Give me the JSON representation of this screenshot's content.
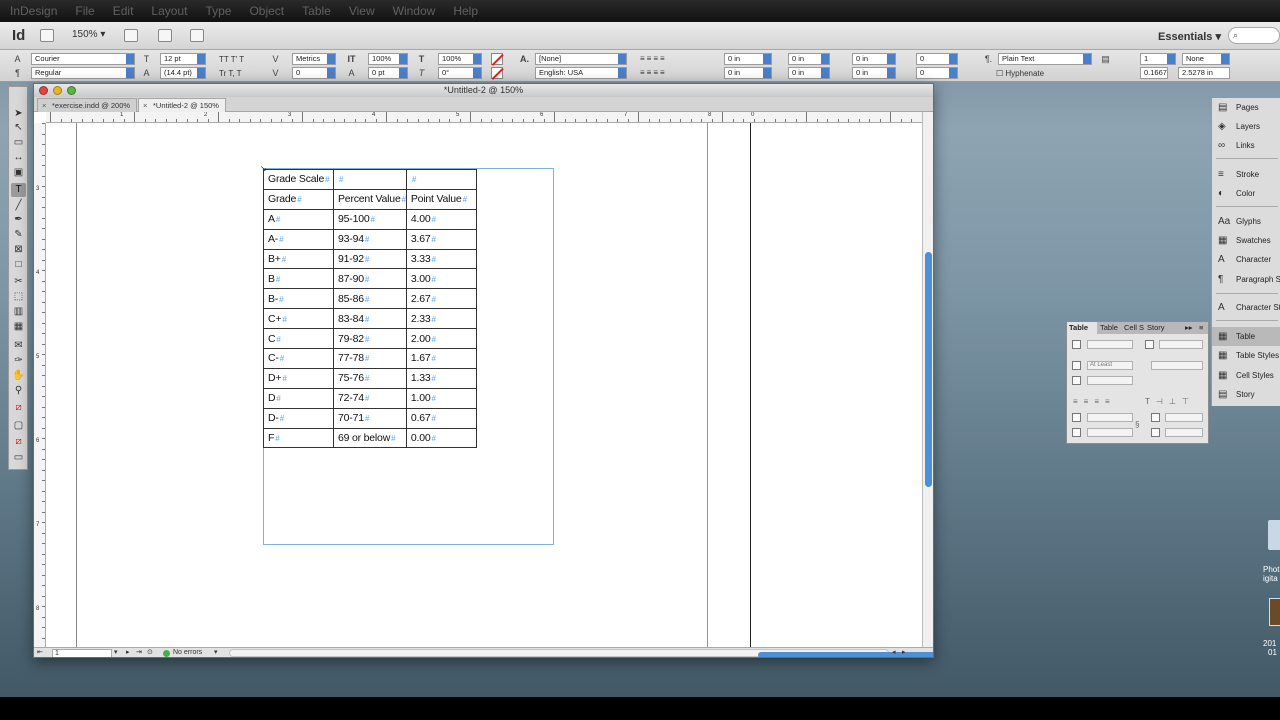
{
  "app": {
    "logo": "Id",
    "zoom": "150%",
    "workspace": "Essentials",
    "search_placeholder": ""
  },
  "control_panel": {
    "font_family": "Courier",
    "font_style": "Regular",
    "font_size": "12 pt",
    "leading": "(14.4 pt)",
    "kerning": "Metrics",
    "tracking": "0",
    "vertical_scale": "100%",
    "horizontal_scale": "100%",
    "baseline_shift": "0 pt",
    "skew": "0°",
    "char_style": "[None]",
    "language": "English: USA",
    "indent_left": "0 in",
    "indent_right": "0 in",
    "space_before": "0 in",
    "space_after": "0 in",
    "drop_cap_lines": "0",
    "drop_cap_chars": "0",
    "paragraph_style": "Plain Text",
    "hyphenate_label": "Hyphenate",
    "columns": "1",
    "gutter": "None",
    "width_value": "0.1667",
    "height_value": "2.5278 in"
  },
  "document": {
    "window_title": "*Untitled-2 @ 150%",
    "tabs": [
      {
        "label": "*exercise.indd @ 200%"
      },
      {
        "label": "*Untitled-2 @ 150%"
      }
    ],
    "ruler_h": [
      "1",
      "2",
      "3",
      "4",
      "5",
      "6",
      "7",
      "8",
      "0"
    ],
    "ruler_v": [
      "3",
      "4",
      "5",
      "6",
      "7",
      "8"
    ],
    "status": {
      "page": "1",
      "errors": "No errors"
    }
  },
  "table": {
    "end_mark": "#",
    "rows": [
      [
        "Grade Scale",
        "",
        ""
      ],
      [
        "Grade",
        "Percent Value",
        "Point Value"
      ],
      [
        "A",
        "95-100",
        "4.00"
      ],
      [
        "A-",
        "93-94",
        "3.67"
      ],
      [
        "B+",
        "91-92",
        "3.33"
      ],
      [
        "B",
        "87-90",
        "3.00"
      ],
      [
        "B-",
        "85-86",
        "2.67"
      ],
      [
        "C+",
        "83-84",
        "2.33"
      ],
      [
        "C",
        "79-82",
        "2.00"
      ],
      [
        "C-",
        "77-78",
        "1.67"
      ],
      [
        "D+",
        "75-76",
        "1.33"
      ],
      [
        "D",
        "72-74",
        "1.00"
      ],
      [
        "D-",
        "70-71",
        "0.67"
      ],
      [
        "F",
        "69 or below",
        "0.00"
      ]
    ]
  },
  "right_dock": {
    "items": [
      {
        "label": "Pages",
        "icon": "pages-icon",
        "glyph": "▤"
      },
      {
        "label": "Layers",
        "icon": "layers-icon",
        "glyph": "◈"
      },
      {
        "label": "Links",
        "icon": "links-icon",
        "glyph": "∞"
      },
      {
        "label": "Stroke",
        "icon": "stroke-icon",
        "glyph": "≡"
      },
      {
        "label": "Color",
        "icon": "color-icon",
        "glyph": "◐"
      },
      {
        "label": "Glyphs",
        "icon": "glyphs-icon",
        "glyph": "Aa"
      },
      {
        "label": "Swatches",
        "icon": "swatches-icon",
        "glyph": "▦"
      },
      {
        "label": "Character",
        "icon": "character-icon",
        "glyph": "A"
      },
      {
        "label": "Paragraph St",
        "icon": "paragraph-styles-icon",
        "glyph": "¶"
      },
      {
        "label": "Character St",
        "icon": "character-styles-icon",
        "glyph": "A"
      },
      {
        "label": "Table",
        "icon": "table-icon",
        "glyph": "▦"
      },
      {
        "label": "Table Styles",
        "icon": "table-styles-icon",
        "glyph": "▦"
      },
      {
        "label": "Cell Styles",
        "icon": "cell-styles-icon",
        "glyph": "▦"
      },
      {
        "label": "Story",
        "icon": "story-icon",
        "glyph": "▤"
      }
    ]
  },
  "table_panel": {
    "tabs": [
      "Table",
      "Table",
      "Cell S",
      "Story"
    ],
    "row_height_mode": "At Least"
  },
  "desktop": {
    "label_1": "Phot",
    "label_2": "igita",
    "label_3": "201",
    "label_4": "01"
  },
  "colors": {
    "accent": "#4f8fd6",
    "frame_guide": "#7fb3de",
    "margin_guide": "#b07fb3",
    "ok_status": "#39b54a"
  }
}
